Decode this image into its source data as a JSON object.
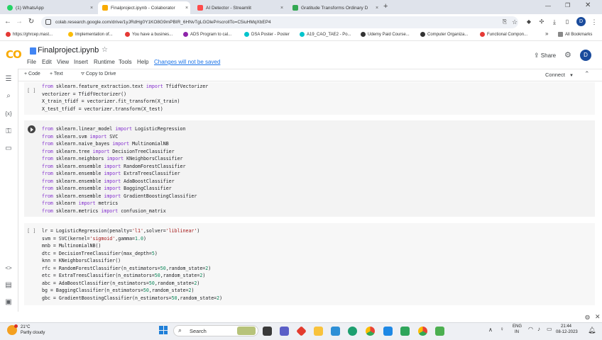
{
  "browser": {
    "tabs": [
      {
        "label": "(1) WhatsApp",
        "color": "#25d366"
      },
      {
        "label": "Finalproject.ipynb - Colaborator",
        "color": "#f9ab00"
      },
      {
        "label": "AI Detector - Streamlit",
        "color": "#ff4b4b"
      },
      {
        "label": "Gratitude Transforms Ordinary D",
        "color": "#34a853"
      }
    ],
    "new_tab": "+",
    "close": "×",
    "url": "colab.research.google.com/drive/1yJRdHg0Y1KO8G9mPBIR_6HNvTgLGOleP#scrollTo=C5iuHMqXbEP4",
    "profile_initial": "D",
    "bookmarks": [
      {
        "label": "https://ghrcep.mast...",
        "color": "#e53935"
      },
      {
        "label": "Implementation of...",
        "color": "#fbbc04"
      },
      {
        "label": "You have a busines...",
        "color": "#e53935"
      },
      {
        "label": "ADS Program to cal...",
        "color": "#8e24aa"
      },
      {
        "label": "DSA Poster - Poster",
        "color": "#00c4cc"
      },
      {
        "label": "A19_CAO_TAE2 - Po...",
        "color": "#00c4cc"
      },
      {
        "label": "Udemy Paid Course...",
        "color": "#333333"
      },
      {
        "label": "Computer Organiza...",
        "color": "#333333"
      },
      {
        "label": "Functional Compon...",
        "color": "#e53935"
      }
    ],
    "bookmarks_more": "»",
    "all_bookmarks": "All Bookmarks"
  },
  "colab": {
    "logo": "CO",
    "title": "Finalproject.ipynb",
    "menus": [
      "File",
      "Edit",
      "View",
      "Insert",
      "Runtime",
      "Tools",
      "Help"
    ],
    "save_status": "Changes will not be saved",
    "share": "Share",
    "avatar": "D",
    "add_code": "+ Code",
    "add_text": "+ Text",
    "copy_to_drive": "Copy to Drive",
    "connect": "Connect",
    "cell1_prompt": "[ ]",
    "cell3_prompt": "[ ]"
  },
  "cells": {
    "cell1": [
      "from sklearn.feature_extraction.text import TfidfVectorizer",
      "vectorizer = TfidfVectorizer()",
      "X_train_tfidf = vectorizer.fit_transform(X_train)",
      "X_test_tfidf = vectorizer.transform(X_test)"
    ],
    "cell2": [
      "from sklearn.linear_model import LogisticRegression",
      "from sklearn.svm import SVC",
      "from sklearn.naive_bayes import MultinomialNB",
      "from sklearn.tree import DecisionTreeClassifier",
      "from sklearn.neighbors import KNeighborsClassifier",
      "from sklearn.ensemble import RandomForestClassifier",
      "from sklearn.ensemble import ExtraTreesClassifier",
      "from sklearn.ensemble import AdaBoostClassifier",
      "from sklearn.ensemble import BaggingClassifier",
      "from sklearn.ensemble import GradientBoostingClassifier",
      "from sklearn import metrics",
      "from sklearn.metrics import confusion_matrix"
    ],
    "cell3": [
      "lr = LogisticRegression(penalty='l1',solver='liblinear')",
      "svm = SVC(kernel='sigmoid',gamma=1.0)",
      "mnb = MultinomialNB()",
      "dtc = DecisionTreeClassifier(max_depth=5)",
      "knn = KNeighborsClassifier()",
      "rfc = RandomForestClassifier(n_estimators=50,random_state=2)",
      "etc = ExtraTreesClassifier(n_estimators=50,random_state=2)",
      "abc = AdaBoostClassifier(n_estimators=50,random_state=2)",
      "bg = BaggingClassifier(n_estimators=50,random_state=2)",
      "gbc = GradientBoostingClassifier(n_estimators=50,random_state=2)"
    ]
  },
  "taskbar": {
    "weather_temp": "21°C",
    "weather_desc": "Partly cloudy",
    "search": "Search",
    "lang_top": "ENG",
    "lang_bottom": "IN",
    "time": "21:44",
    "date": "08-12-2023"
  }
}
